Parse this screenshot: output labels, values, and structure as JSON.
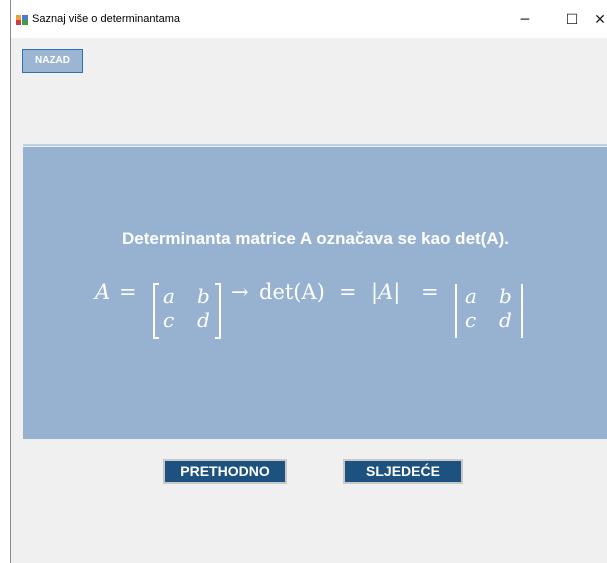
{
  "window": {
    "title": "Saznaj više o determinantama",
    "minimize_glyph": "─",
    "maximize_glyph": "☐",
    "close_glyph": "✕"
  },
  "toolbar": {
    "back_label": "NAZAD"
  },
  "content": {
    "heading": "Determinanta matrice A označava se kao det(A).",
    "formula": {
      "lhs": "A",
      "eq": "=",
      "matrix": {
        "r1": [
          "a",
          "b"
        ],
        "r2": [
          "c",
          "d"
        ]
      },
      "arrow": "→",
      "det_label": "det(A)",
      "eq2": "=",
      "abs_label": "|A|",
      "eq3": "="
    }
  },
  "navigation": {
    "prev_label": "PRETHODNO",
    "next_label": "SLJEDEĆE"
  },
  "colors": {
    "panel": "#97b2d0",
    "button": "#1c5180",
    "back_button": "#9cb5d2"
  }
}
